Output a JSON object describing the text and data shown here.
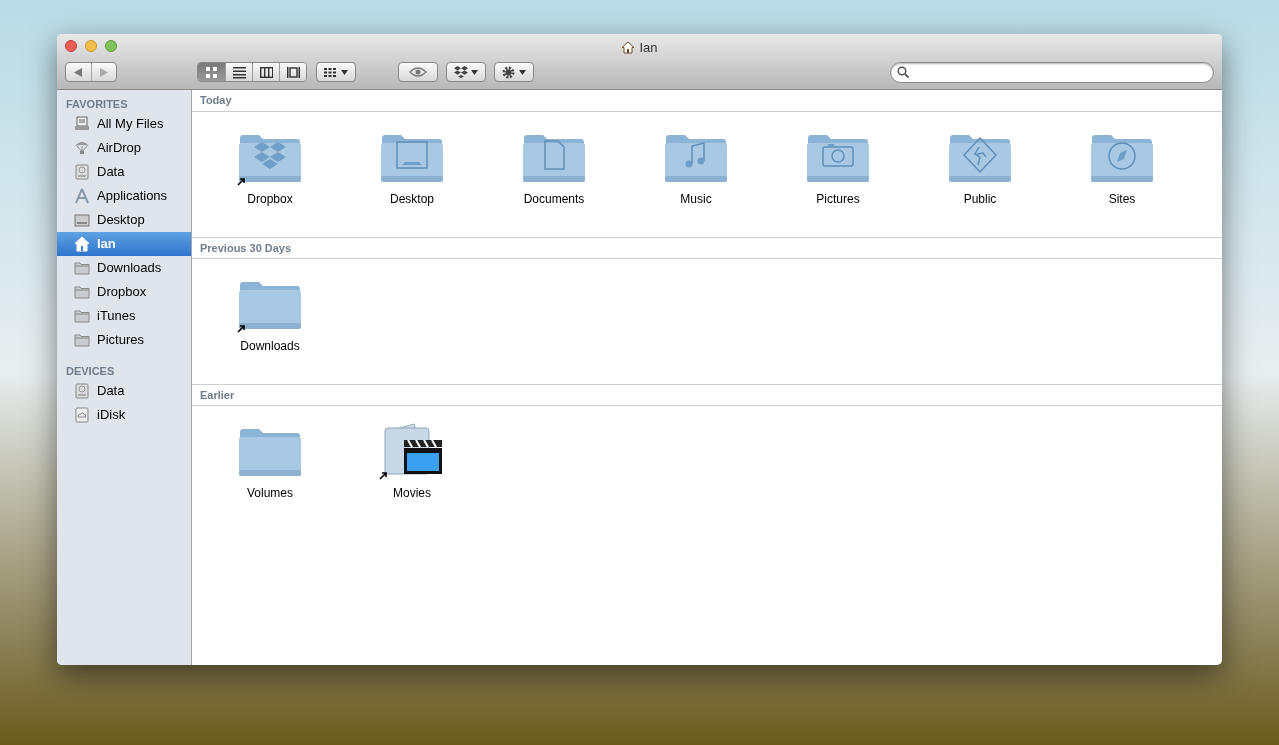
{
  "window": {
    "title": "Ian"
  },
  "view_modes": [
    {
      "kind": "icons",
      "selected": true
    },
    {
      "kind": "list",
      "selected": false
    },
    {
      "kind": "columns",
      "selected": false
    },
    {
      "kind": "coverflow",
      "selected": false
    }
  ],
  "sidebar": {
    "groups": [
      {
        "heading": "FAVORITES",
        "items": [
          {
            "label": "All My Files",
            "kind": "files",
            "selected": false
          },
          {
            "label": "AirDrop",
            "kind": "airdrop",
            "selected": false
          },
          {
            "label": "Data",
            "kind": "disk",
            "selected": false
          },
          {
            "label": "Applications",
            "kind": "apps",
            "selected": false
          },
          {
            "label": "Desktop",
            "kind": "desktop",
            "selected": false
          },
          {
            "label": "Ian",
            "kind": "home",
            "selected": true
          },
          {
            "label": "Downloads",
            "kind": "folder",
            "selected": false
          },
          {
            "label": "Dropbox",
            "kind": "folder",
            "selected": false
          },
          {
            "label": "iTunes",
            "kind": "folder",
            "selected": false
          },
          {
            "label": "Pictures",
            "kind": "folder",
            "selected": false
          }
        ]
      },
      {
        "heading": "DEVICES",
        "items": [
          {
            "label": "Data",
            "kind": "disk",
            "selected": false
          },
          {
            "label": "iDisk",
            "kind": "idisk",
            "selected": false
          }
        ]
      }
    ]
  },
  "sections": [
    {
      "heading": "Today",
      "items": [
        {
          "label": "Dropbox",
          "kind": "dropbox",
          "alias": true
        },
        {
          "label": "Desktop",
          "kind": "desktop",
          "alias": false
        },
        {
          "label": "Documents",
          "kind": "documents",
          "alias": false
        },
        {
          "label": "Music",
          "kind": "music",
          "alias": false
        },
        {
          "label": "Pictures",
          "kind": "pictures",
          "alias": false
        },
        {
          "label": "Public",
          "kind": "public",
          "alias": false
        },
        {
          "label": "Sites",
          "kind": "sites",
          "alias": false
        }
      ]
    },
    {
      "heading": "Previous 30 Days",
      "items": [
        {
          "label": "Downloads",
          "kind": "plain",
          "alias": true
        }
      ]
    },
    {
      "heading": "Earlier",
      "items": [
        {
          "label": "Volumes",
          "kind": "plain",
          "alias": false
        },
        {
          "label": "Movies",
          "kind": "movies",
          "alias": true
        }
      ]
    }
  ]
}
